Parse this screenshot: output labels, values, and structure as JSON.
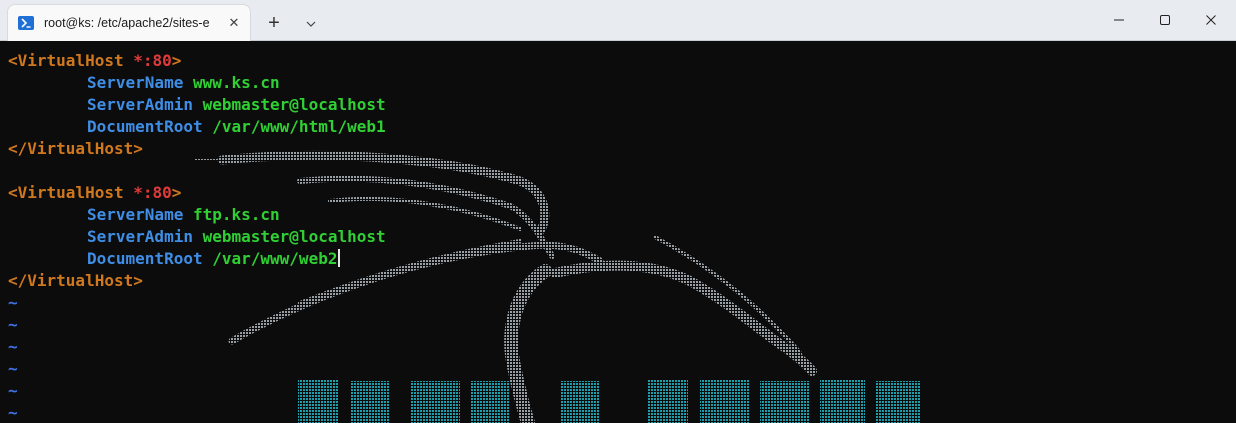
{
  "window": {
    "tab_title": "root@ks: /etc/apache2/sites-e",
    "tab_close": "✕",
    "new_tab": "+"
  },
  "terminal": {
    "blocks": [
      {
        "open_prefix": "<VirtualHost ",
        "open_star": "*",
        "open_port": ":80",
        "open_suffix": ">",
        "directives": [
          {
            "key": "ServerName",
            "value": "www.ks.cn"
          },
          {
            "key": "ServerAdmin",
            "value": "webmaster@localhost"
          },
          {
            "key": "DocumentRoot",
            "value": "/var/www/html/web1"
          }
        ],
        "close": "</VirtualHost>"
      },
      {
        "open_prefix": "<VirtualHost ",
        "open_star": "*",
        "open_port": ":80",
        "open_suffix": ">",
        "directives": [
          {
            "key": "ServerName",
            "value": "ftp.ks.cn"
          },
          {
            "key": "ServerAdmin",
            "value": "webmaster@localhost"
          },
          {
            "key": "DocumentRoot",
            "value": "/var/www/web2"
          }
        ],
        "close": "</VirtualHost>"
      }
    ],
    "tilde": "~",
    "colors": {
      "background": "#0c0c0c",
      "tag": "#d0781e",
      "wildcard": "#e03a3a",
      "directive": "#3f8ee6",
      "value": "#30d034",
      "empty_line_marker": "#3f72e6",
      "background_art": "#9aa4aa",
      "background_logo_text": "#1fb8c8"
    },
    "background_art": "kali-dragon-logo"
  }
}
